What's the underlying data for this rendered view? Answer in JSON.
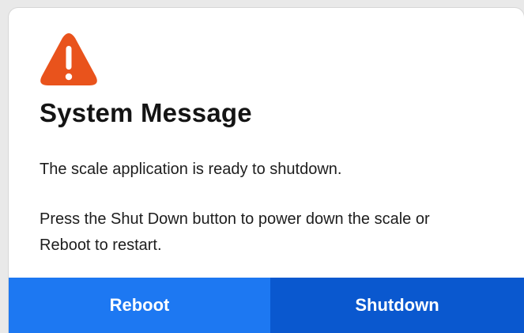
{
  "dialog": {
    "icon": "warning-triangle-icon",
    "title": "System Message",
    "message_line1": "The scale application is ready to shutdown.",
    "message_line2": "Press the Shut Down button to power down the scale or Reboot to restart."
  },
  "buttons": {
    "reboot_label": "Reboot",
    "shutdown_label": "Shutdown"
  },
  "colors": {
    "warning": "#e9531c",
    "reboot_bg": "#1d78f2",
    "shutdown_bg": "#0a58cf",
    "text": "#141414"
  }
}
